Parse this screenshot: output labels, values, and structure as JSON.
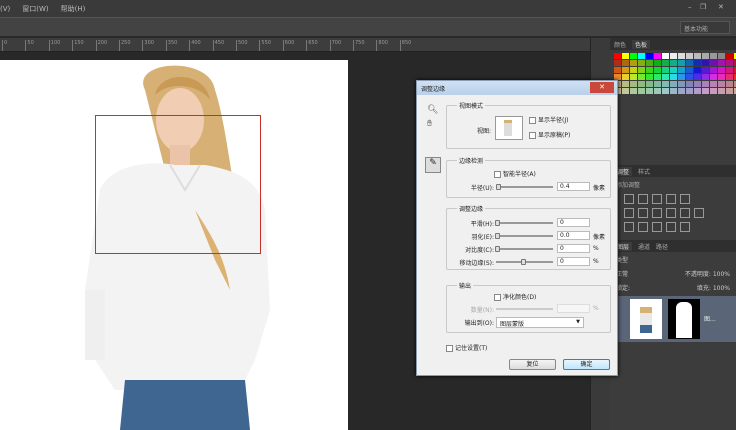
{
  "menu": {
    "items": [
      "(V)",
      "窗口(W)",
      "帮助(H)"
    ]
  },
  "window": {
    "minimize": "–",
    "restore": "❐",
    "close": "✕"
  },
  "options": {
    "workspace": "基本功能"
  },
  "ruler": {
    "ticks": [
      "0",
      "50",
      "100",
      "150",
      "200",
      "250",
      "300",
      "350",
      "400",
      "450",
      "500",
      "550",
      "600",
      "650",
      "700",
      "750",
      "800",
      "850"
    ]
  },
  "panels": {
    "color_tabs": [
      "颜色",
      "色板"
    ],
    "adjust_tabs": [
      "调整",
      "样式"
    ],
    "adjust_heading": "添加调整",
    "layers_tabs": [
      "图层",
      "通道",
      "路径"
    ],
    "layers_filter": "类型",
    "blend_mode": "正常",
    "opacity_label": "不透明度:",
    "opacity_value": "100%",
    "lock_label": "锁定:",
    "fill_label": "填充:",
    "fill_value": "100%",
    "layer_name": "图..."
  },
  "dialog": {
    "title": "调整边缘",
    "close": "✕",
    "view_mode": {
      "title": "视图模式",
      "view_label": "视图:",
      "show_radius": "显示半径(J)",
      "show_original": "显示原稿(P)",
      "show_radius_checked": false,
      "show_original_checked": false
    },
    "edge_detection": {
      "title": "边缘检测",
      "smart_radius": "智能半径(A)",
      "smart_radius_checked": false,
      "radius_label": "半径(U):",
      "radius_value": "0.4",
      "radius_unit": "像素",
      "radius_slider": 0.02
    },
    "adjust_edge": {
      "title": "调整边缘",
      "rows": [
        {
          "label": "平滑(H):",
          "value": "0",
          "unit": "",
          "slider": 0
        },
        {
          "label": "羽化(E):",
          "value": "0.0",
          "unit": "像素",
          "slider": 0
        },
        {
          "label": "对比度(C):",
          "value": "0",
          "unit": "%",
          "slider": 0
        },
        {
          "label": "移动边缘(S):",
          "value": "0",
          "unit": "%",
          "slider": 0.5
        }
      ]
    },
    "output": {
      "title": "输出",
      "decontaminate": "净化颜色(D)",
      "decontaminate_checked": false,
      "amount_label": "数量(N):",
      "amount_unit": "%",
      "output_to_label": "输出到(O):",
      "output_to_value": "图层蒙版"
    },
    "remember": "记住设置(T)",
    "remember_checked": false,
    "reset": "复位",
    "ok": "确定"
  },
  "colors": {
    "accent": "#c8302c",
    "dialog_bg": "#f0f0f0",
    "ui_dark": "#3c3c3c"
  }
}
